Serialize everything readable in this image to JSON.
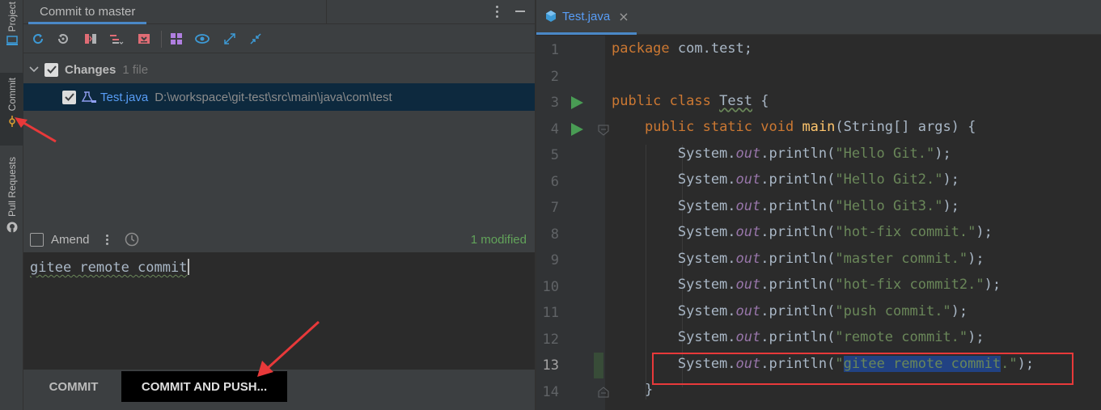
{
  "toolwindow_tabs": {
    "project": "Project",
    "commit": "Commit",
    "pull_requests": "Pull Requests"
  },
  "commit_panel": {
    "tab_title": "Commit to master",
    "changes": {
      "label": "Changes",
      "count": "1 file"
    },
    "file": {
      "name": "Test.java",
      "path": "D:\\workspace\\git-test\\src\\main\\java\\com\\test"
    },
    "amend_label": "Amend",
    "modified_status": "1 modified",
    "message": "gitee remote commit",
    "commit_button": "COMMIT",
    "commit_and_push_button": "COMMIT AND PUSH..."
  },
  "editor": {
    "tab_label": "Test.java",
    "line_numbers": [
      "1",
      "2",
      "3",
      "4",
      "5",
      "6",
      "7",
      "8",
      "9",
      "10",
      "11",
      "12",
      "13",
      "14"
    ],
    "current_line": "13"
  },
  "colors": {
    "accent_blue": "#4a88c7",
    "highlight_red": "#e8393a",
    "selection": "#214283",
    "run_green": "#499c54"
  },
  "icons": [
    "refresh-icon",
    "rollback-icon",
    "diff-icon",
    "group-icon",
    "shelve-icon",
    "layout-icon",
    "eye-icon",
    "expand-icon",
    "collapse-icon",
    "history-icon",
    "run-icon",
    "java-file-icon"
  ]
}
